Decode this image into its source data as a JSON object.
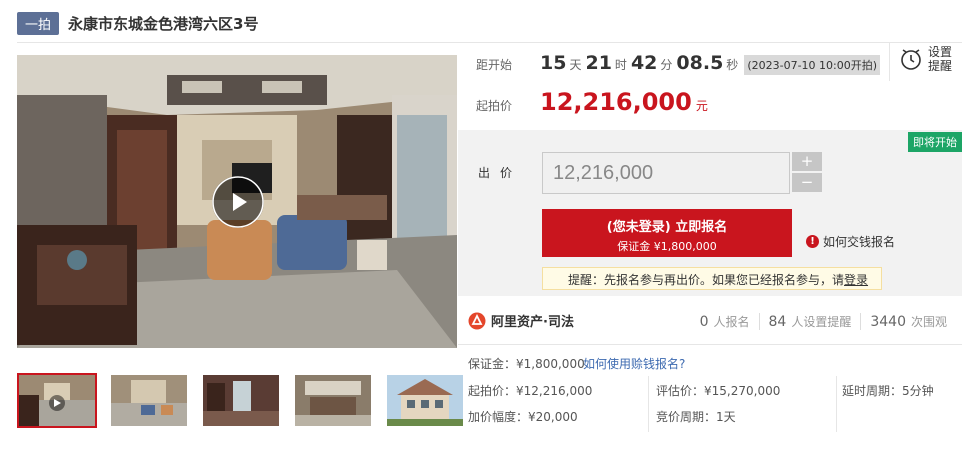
{
  "header": {
    "badge": "一拍",
    "title": "永康市东城金色港湾六区3号"
  },
  "countdown": {
    "label": "距开始",
    "days": "15",
    "days_unit": "天",
    "hours": "21",
    "hours_unit": "时",
    "minutes": "42",
    "minutes_unit": "分",
    "seconds": "08.5",
    "seconds_unit": "秒",
    "start_time": "(2023-07-10 10:00开拍)"
  },
  "remind": {
    "label": "设置\n提醒",
    "line1": "设置",
    "line2": "提醒",
    "icon": "alarm-clock-icon"
  },
  "start_price": {
    "label": "起拍价",
    "value": "12,216,000",
    "unit": "元"
  },
  "bid": {
    "status_tag": "即将开始",
    "label": "出价",
    "input_value": "12,216,000",
    "plus": "+",
    "minus": "−",
    "signup_line1": "(您未登录) 立即报名",
    "signup_line2": "保证金 ¥1,800,000",
    "how_pay": "如何交钱报名",
    "notice_prefix": "提醒：先报名参与再出价。如果您已经报名参与，请",
    "notice_link": "登录"
  },
  "brand": {
    "name": "阿里资产·司法"
  },
  "stats": [
    {
      "num": "0",
      "label": "人报名"
    },
    {
      "num": "84",
      "label": "人设置提醒"
    },
    {
      "num": "3440",
      "label": "次围观"
    }
  ],
  "details": {
    "deposit": "保证金：¥1,800,000",
    "deposit_link": "如何使用赊钱报名?",
    "start_price": "起拍价：¥12,216,000",
    "increment": "加价幅度：¥20,000",
    "appraisal": "评估价：¥15,270,000",
    "bid_cycle": "竞价周期：1天",
    "delay": "延时周期：5分钟"
  },
  "colors": {
    "accent": "#c9151e",
    "badge": "#5d7096",
    "status": "#1da566"
  }
}
